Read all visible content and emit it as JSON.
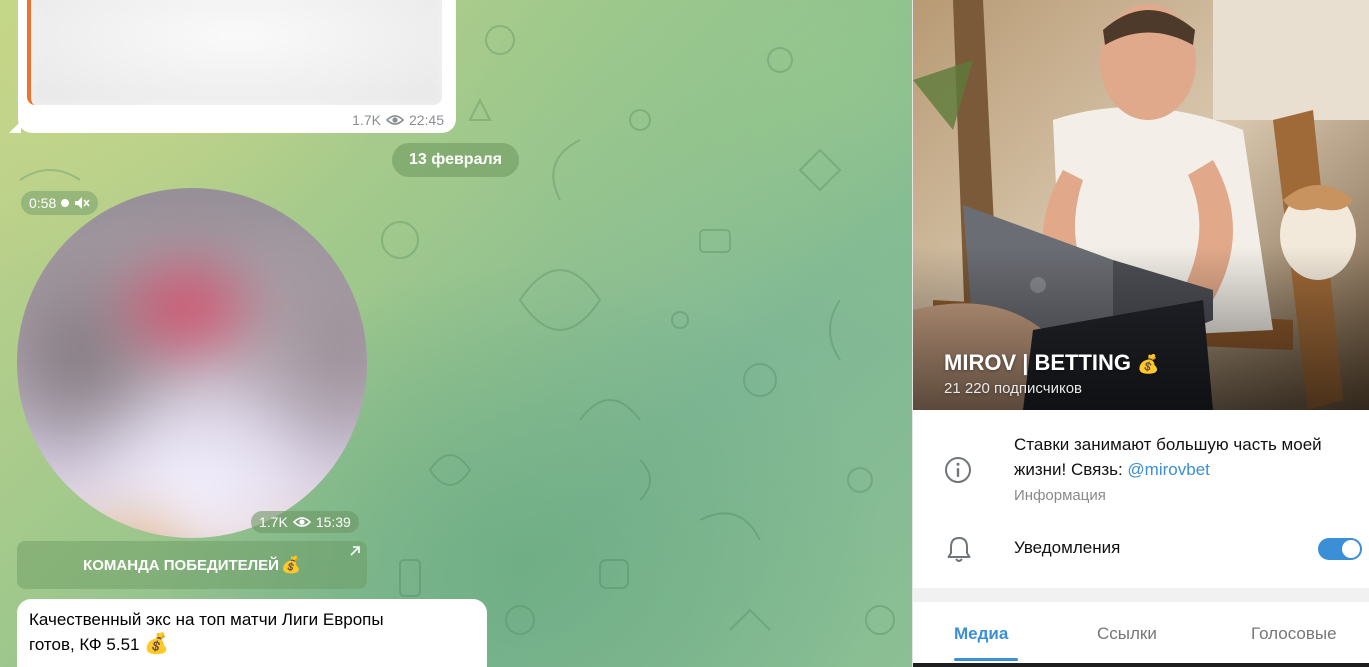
{
  "chat": {
    "top_message": {
      "views": "1.7K",
      "time": "22:45"
    },
    "date_separator": "13 февраля",
    "video_message": {
      "duration": "0:58",
      "views": "1.7K",
      "time": "15:39",
      "muted": true
    },
    "inline_button": {
      "label": "КОМАНДА ПОБЕДИТЕЛЕЙ",
      "emoji": "💰"
    },
    "text_message": {
      "line1": "Качественный экс на топ матчи Лиги Европы",
      "line2": "готов, КФ 5.51",
      "emoji": "💰"
    }
  },
  "channel_info": {
    "title": "MIROV | BETTING",
    "title_emoji": "💰",
    "subscribers": "21 220 подписчиков",
    "description_text": "Ставки занимают большую часть моей жизни! Связь: ",
    "description_link": "@mirovbet",
    "description_caption": "Информация",
    "notifications_label": "Уведомления",
    "notifications_enabled": true,
    "tabs": [
      {
        "label": "Медиа",
        "active": true
      },
      {
        "label": "Ссылки",
        "active": false
      },
      {
        "label": "Голосовые",
        "active": false
      }
    ]
  },
  "colors": {
    "accent": "#3a8fd6",
    "chat_bg": "#9fc88c",
    "media_border": "#e9752e"
  },
  "icons": [
    "eye-icon",
    "mute-icon",
    "external-link-icon",
    "info-icon",
    "bell-icon",
    "toggle-switch"
  ]
}
